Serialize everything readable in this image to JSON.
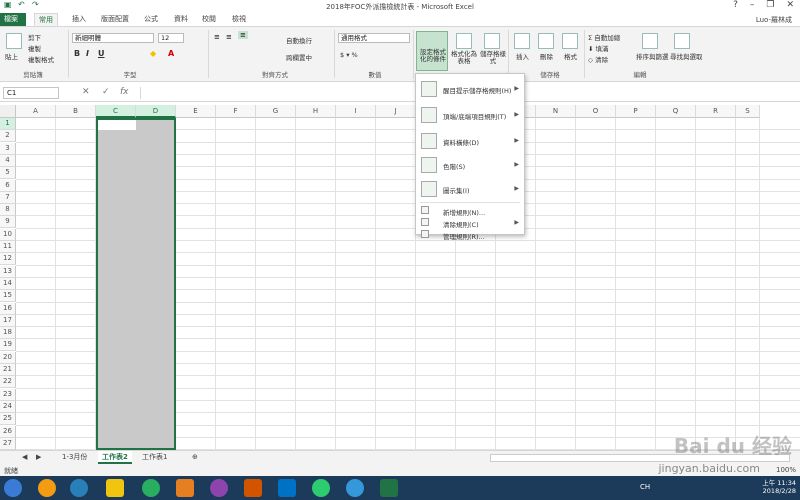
{
  "window": {
    "title": "2018年FOC外派擔檢統計表 - Microsoft Excel",
    "user": "Luo-羅林成"
  },
  "tabs": [
    "檔案",
    "常用",
    "插入",
    "版面配置",
    "公式",
    "資料",
    "校閱",
    "檢視"
  ],
  "ribbon": {
    "clipboard": {
      "cut": "剪下",
      "copy": "複製",
      "format_painter": "複製格式",
      "paste": "貼上",
      "label": "剪貼簿"
    },
    "font": {
      "name": "新細明體",
      "size": "12",
      "label": "字型"
    },
    "alignment": {
      "wrap": "自動換行",
      "merge": "跨欄置中",
      "label": "對齊方式"
    },
    "number": {
      "format": "通用格式",
      "label": "數值"
    },
    "styles": {
      "conditional": "設定格式化的條件",
      "table": "格式化為表格",
      "cell": "儲存格樣式"
    },
    "cells": {
      "insert": "插入",
      "delete": "刪除",
      "format": "格式",
      "label": "儲存格"
    },
    "editing": {
      "autosum": "自動加總",
      "fill": "填滿",
      "clear": "清除",
      "sort": "排序與篩選",
      "find": "尋找與選取",
      "label": "編輯"
    }
  },
  "formula": {
    "namebox": "C1",
    "fx": "fx"
  },
  "columns": [
    "A",
    "B",
    "C",
    "D",
    "E",
    "F",
    "G",
    "H",
    "I",
    "J",
    "K",
    "L",
    "M",
    "N",
    "O",
    "P",
    "Q",
    "R",
    "S"
  ],
  "rows": [
    "1",
    "2",
    "3",
    "4",
    "5",
    "6",
    "7",
    "8",
    "9",
    "10",
    "11",
    "12",
    "13",
    "14",
    "15",
    "16",
    "17",
    "18",
    "19",
    "20",
    "21",
    "22",
    "23",
    "24",
    "25",
    "26",
    "27"
  ],
  "menu": {
    "items": [
      {
        "label": "醒目提示儲存格規則(H)",
        "submenu": true
      },
      {
        "label": "頂端/底端項目規則(T)",
        "submenu": true
      },
      {
        "label": "資料橫條(D)",
        "submenu": true
      },
      {
        "label": "色階(S)",
        "submenu": true
      },
      {
        "label": "圖示集(I)",
        "submenu": true
      }
    ],
    "small_items": [
      {
        "label": "新增規則(N)...",
        "submenu": false
      },
      {
        "label": "清除規則(C)",
        "submenu": true
      },
      {
        "label": "管理規則(R)...",
        "submenu": false
      }
    ]
  },
  "sheets": [
    "1-3月份",
    "工作表2",
    "工作表1"
  ],
  "active_sheet": "工作表2",
  "status": {
    "ready": "就緒",
    "zoom": "100%"
  },
  "tray": {
    "time": "上午 11:34",
    "date": "2018/2/28",
    "lang": "CH"
  },
  "watermark": {
    "brand": "Bai du 经验",
    "url": "jingyan.baidu.com"
  },
  "colors": {
    "accent": "#217346",
    "selection": "#c9c9c9",
    "taskbar": "#1c3b5a"
  }
}
